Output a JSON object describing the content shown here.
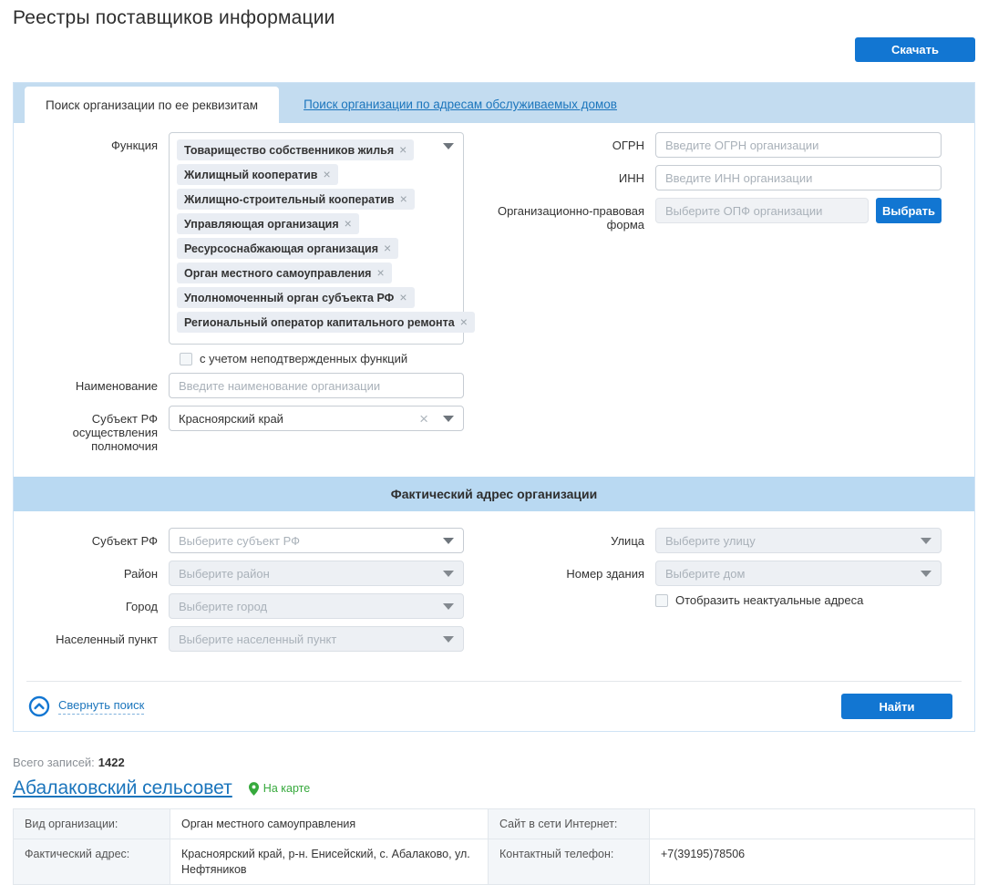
{
  "page": {
    "title": "Реестры поставщиков информации"
  },
  "toolbar": {
    "download_label": "Скачать"
  },
  "tabs": {
    "by_requisites": "Поиск организации по ее реквизитам",
    "by_addresses": "Поиск организации по адресам обслуживаемых домов"
  },
  "search_form": {
    "function": {
      "label": "Функция",
      "chips": [
        "Товарищество собственников жилья",
        "Жилищный кооператив",
        "Жилищно-строительный кооператив",
        "Управляющая организация",
        "Ресурсоснабжающая организация",
        "Орган местного самоуправления",
        "Уполномоченный орган субъекта РФ",
        "Региональный оператор капитального ремонта"
      ]
    },
    "unconfirmed_checkbox_label": "с учетом неподтвержденных функций",
    "name": {
      "label": "Наименование",
      "placeholder": "Введите наименование организации"
    },
    "region_authority": {
      "label": "Субъект РФ осуществления полномочия",
      "value": "Красноярский край"
    },
    "ogrn": {
      "label": "ОГРН",
      "placeholder": "Введите ОГРН организации"
    },
    "inn": {
      "label": "ИНН",
      "placeholder": "Введите ИНН организации"
    },
    "opf": {
      "label": "Организационно-правовая форма",
      "placeholder": "Выберите ОПФ организации",
      "button_label": "Выбрать"
    },
    "address_section_title": "Фактический адрес организации",
    "address": {
      "region": {
        "label": "Субъект РФ",
        "placeholder": "Выберите субъект РФ"
      },
      "district": {
        "label": "Район",
        "placeholder": "Выберите район"
      },
      "city": {
        "label": "Город",
        "placeholder": "Выберите город"
      },
      "settlement": {
        "label": "Населенный пункт",
        "placeholder": "Выберите населенный пункт"
      },
      "street": {
        "label": "Улица",
        "placeholder": "Выберите улицу"
      },
      "house": {
        "label": "Номер здания",
        "placeholder": "Выберите дом"
      },
      "inactive_checkbox_label": "Отобразить неактуальные адреса"
    },
    "collapse_label": "Свернуть поиск",
    "find_label": "Найти"
  },
  "results": {
    "total_label": "Всего записей:",
    "total_value": "1422",
    "record": {
      "title": "Абалаковский сельсовет",
      "map_label": "На карте",
      "fields": [
        {
          "label": "Вид организации:",
          "value": "Орган местного самоуправления"
        },
        {
          "label": "Сайт в сети Интернет:",
          "value": ""
        },
        {
          "label": "Фактический адрес:",
          "value": "Красноярский край, р-н. Енисейский, с. Абалаково, ул. Нефтяников"
        },
        {
          "label": "Контактный телефон:",
          "value": "+7(39195)78506"
        }
      ]
    }
  },
  "colors": {
    "accent_blue": "#1276d2",
    "link_blue": "#1b75bc",
    "tab_band": "#c3dcf0",
    "section_band": "#b9d9f2",
    "map_green": "#36a93c"
  }
}
